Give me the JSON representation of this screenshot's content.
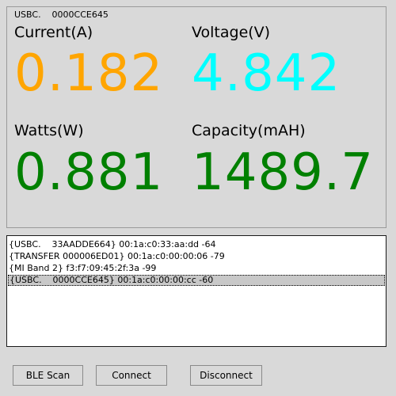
{
  "meter": {
    "device": "USBC.    0000CCE645",
    "current_label": "Current(A)",
    "current_value": "0.182",
    "voltage_label": "Voltage(V)",
    "voltage_value": "4.842",
    "watts_label": "Watts(W)",
    "watts_value": "0.881",
    "capacity_label": "Capacity(mAH)",
    "capacity_value": "1489.7"
  },
  "colors": {
    "current": "#ffa500",
    "voltage": "#00ffff",
    "watts": "#008000",
    "capacity": "#008000"
  },
  "devices": [
    "{USBC.    33AADDE664} 00:1a:c0:33:aa:dd -64",
    "{TRANSFER 000006ED01} 00:1a:c0:00:00:06 -79",
    "{MI Band 2} f3:f7:09:45:2f:3a -99",
    "{USBC.    0000CCE645} 00:1a:c0:00:00:cc -60"
  ],
  "selected_device_index": 3,
  "buttons": {
    "scan": "BLE Scan",
    "connect": "Connect",
    "disconnect": "Disconnect"
  }
}
